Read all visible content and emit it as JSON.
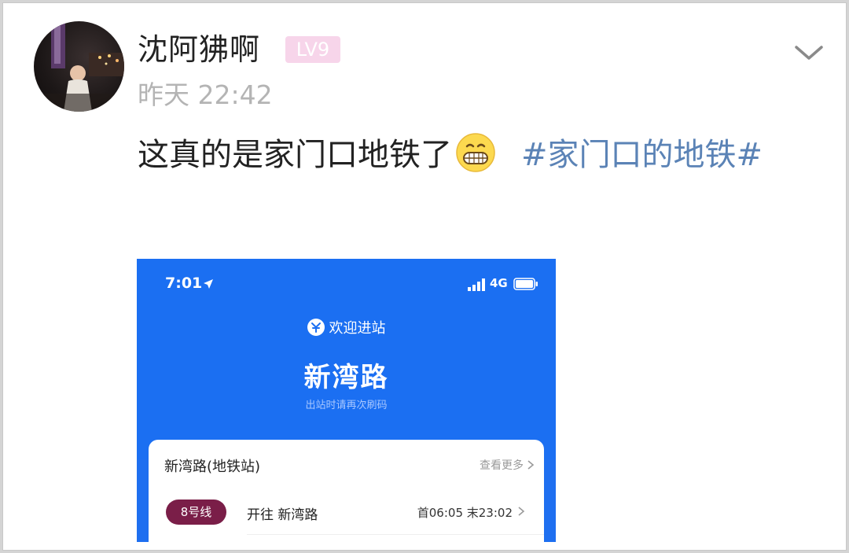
{
  "post": {
    "username": "沈阿狒啊",
    "level": "LV9",
    "timestamp": "昨天 22:42",
    "text": "这真的是家门口地铁了",
    "emoji": "grinning-face-emoji",
    "hashtag": "#家门口的地铁#"
  },
  "screenshot": {
    "status_time": "7:01",
    "network": "4G",
    "welcome": "欢迎进站",
    "station": "新湾路",
    "exit_hint": "出站时请再次刷码",
    "card_title": "新湾路(地铁站)",
    "card_more": "查看更多",
    "line_badge": "8号线",
    "direction": "开往 新湾路",
    "schedule": "首06:05 末23:02"
  },
  "colors": {
    "hashtag": "#5b83b6",
    "level_badge": "#f7d5ea",
    "metro_blue": "#1b6ff2",
    "line_8": "#7a1e48"
  }
}
